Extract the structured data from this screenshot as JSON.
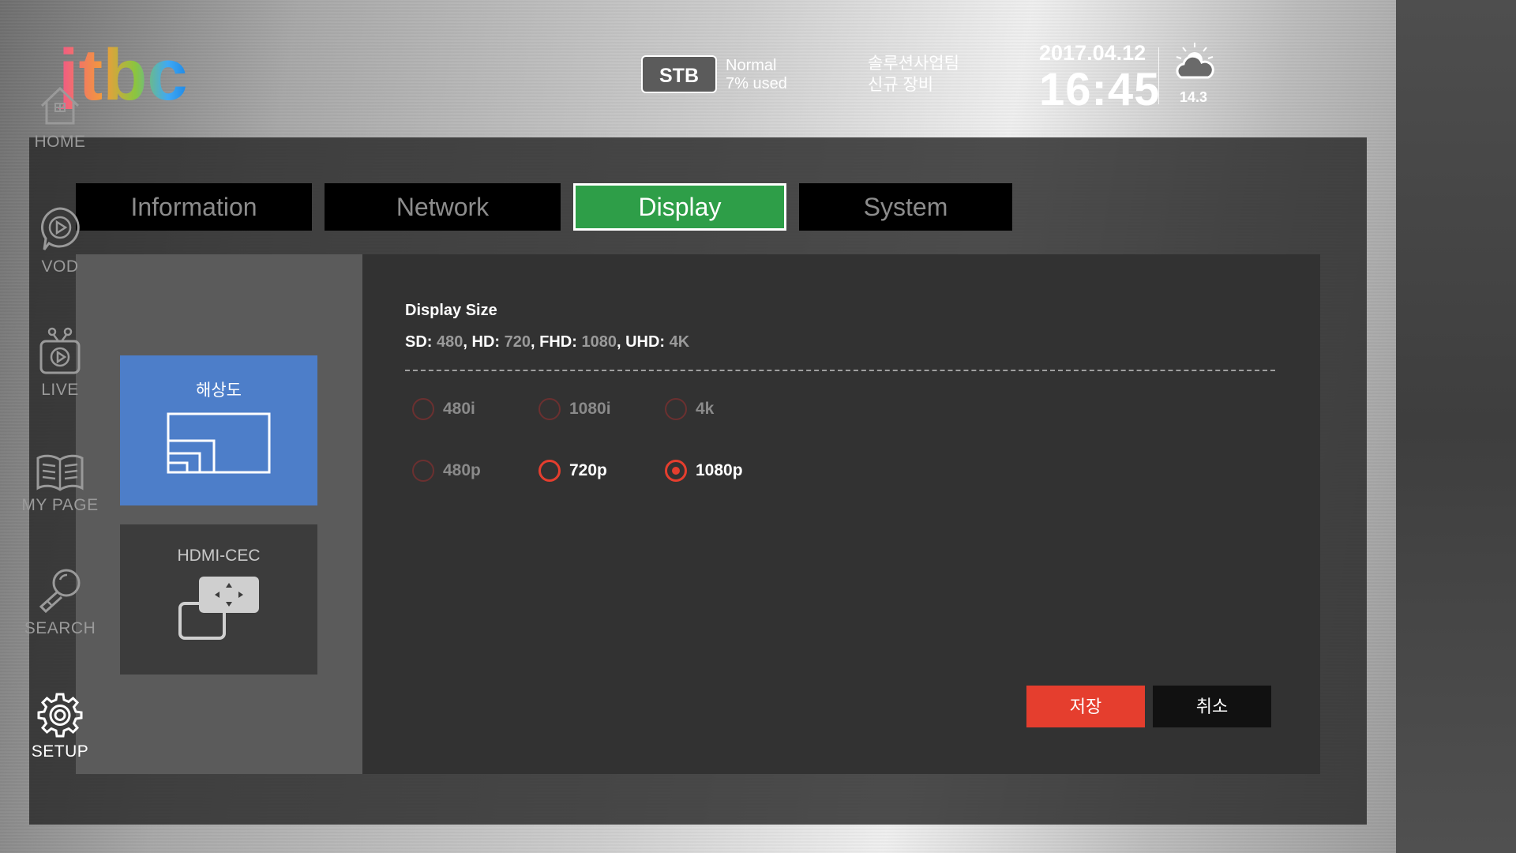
{
  "brand": {
    "logo_text": "jtbc"
  },
  "header": {
    "device": "STB",
    "status_line1": "Normal",
    "status_line2": "7% used",
    "dept_line1": "솔루션사업팀",
    "dept_line2": "신규 장비",
    "date": "2017.04.12",
    "time": "16:45",
    "weather_icon": "cloud-sun-icon",
    "temperature": "14.3"
  },
  "tabs": [
    {
      "label": "Information",
      "active": false
    },
    {
      "label": "Network",
      "active": false
    },
    {
      "label": "Display",
      "active": true
    },
    {
      "label": "System",
      "active": false
    }
  ],
  "submenu": [
    {
      "label": "해상도",
      "icon": "resolution-icon",
      "active": true
    },
    {
      "label": "HDMI-CEC",
      "icon": "hdmi-cec-icon",
      "active": false
    }
  ],
  "display_size": {
    "title": "Display Size",
    "sd_label": "SD:",
    "sd_value": "480",
    "hd_label": "HD:",
    "hd_value": "720",
    "fhd_label": "FHD:",
    "fhd_value": "1080",
    "uhd_label": "UHD:",
    "uhd_value": "4K"
  },
  "resolutions": [
    {
      "label": "480i",
      "enabled": false,
      "checked": false
    },
    {
      "label": "1080i",
      "enabled": false,
      "checked": false
    },
    {
      "label": "4k",
      "enabled": false,
      "checked": false
    },
    {
      "label": "480p",
      "enabled": false,
      "checked": false
    },
    {
      "label": "720p",
      "enabled": true,
      "checked": false
    },
    {
      "label": "1080p",
      "enabled": true,
      "checked": true
    }
  ],
  "actions": {
    "save": "저장",
    "cancel": "취소"
  },
  "sidebar": [
    {
      "label": "HOME",
      "icon": "home-icon",
      "active": false
    },
    {
      "label": "VOD",
      "icon": "vod-icon",
      "active": false
    },
    {
      "label": "LIVE",
      "icon": "live-tv-icon",
      "active": false
    },
    {
      "label": "MY PAGE",
      "icon": "book-icon",
      "active": false
    },
    {
      "label": "SEARCH",
      "icon": "search-icon",
      "active": false
    },
    {
      "label": "SETUP",
      "icon": "gear-icon",
      "active": true
    }
  ],
  "colors": {
    "accent_green": "#2e9e48",
    "accent_red": "#e53e2e",
    "card_blue": "#4d7ec9"
  }
}
